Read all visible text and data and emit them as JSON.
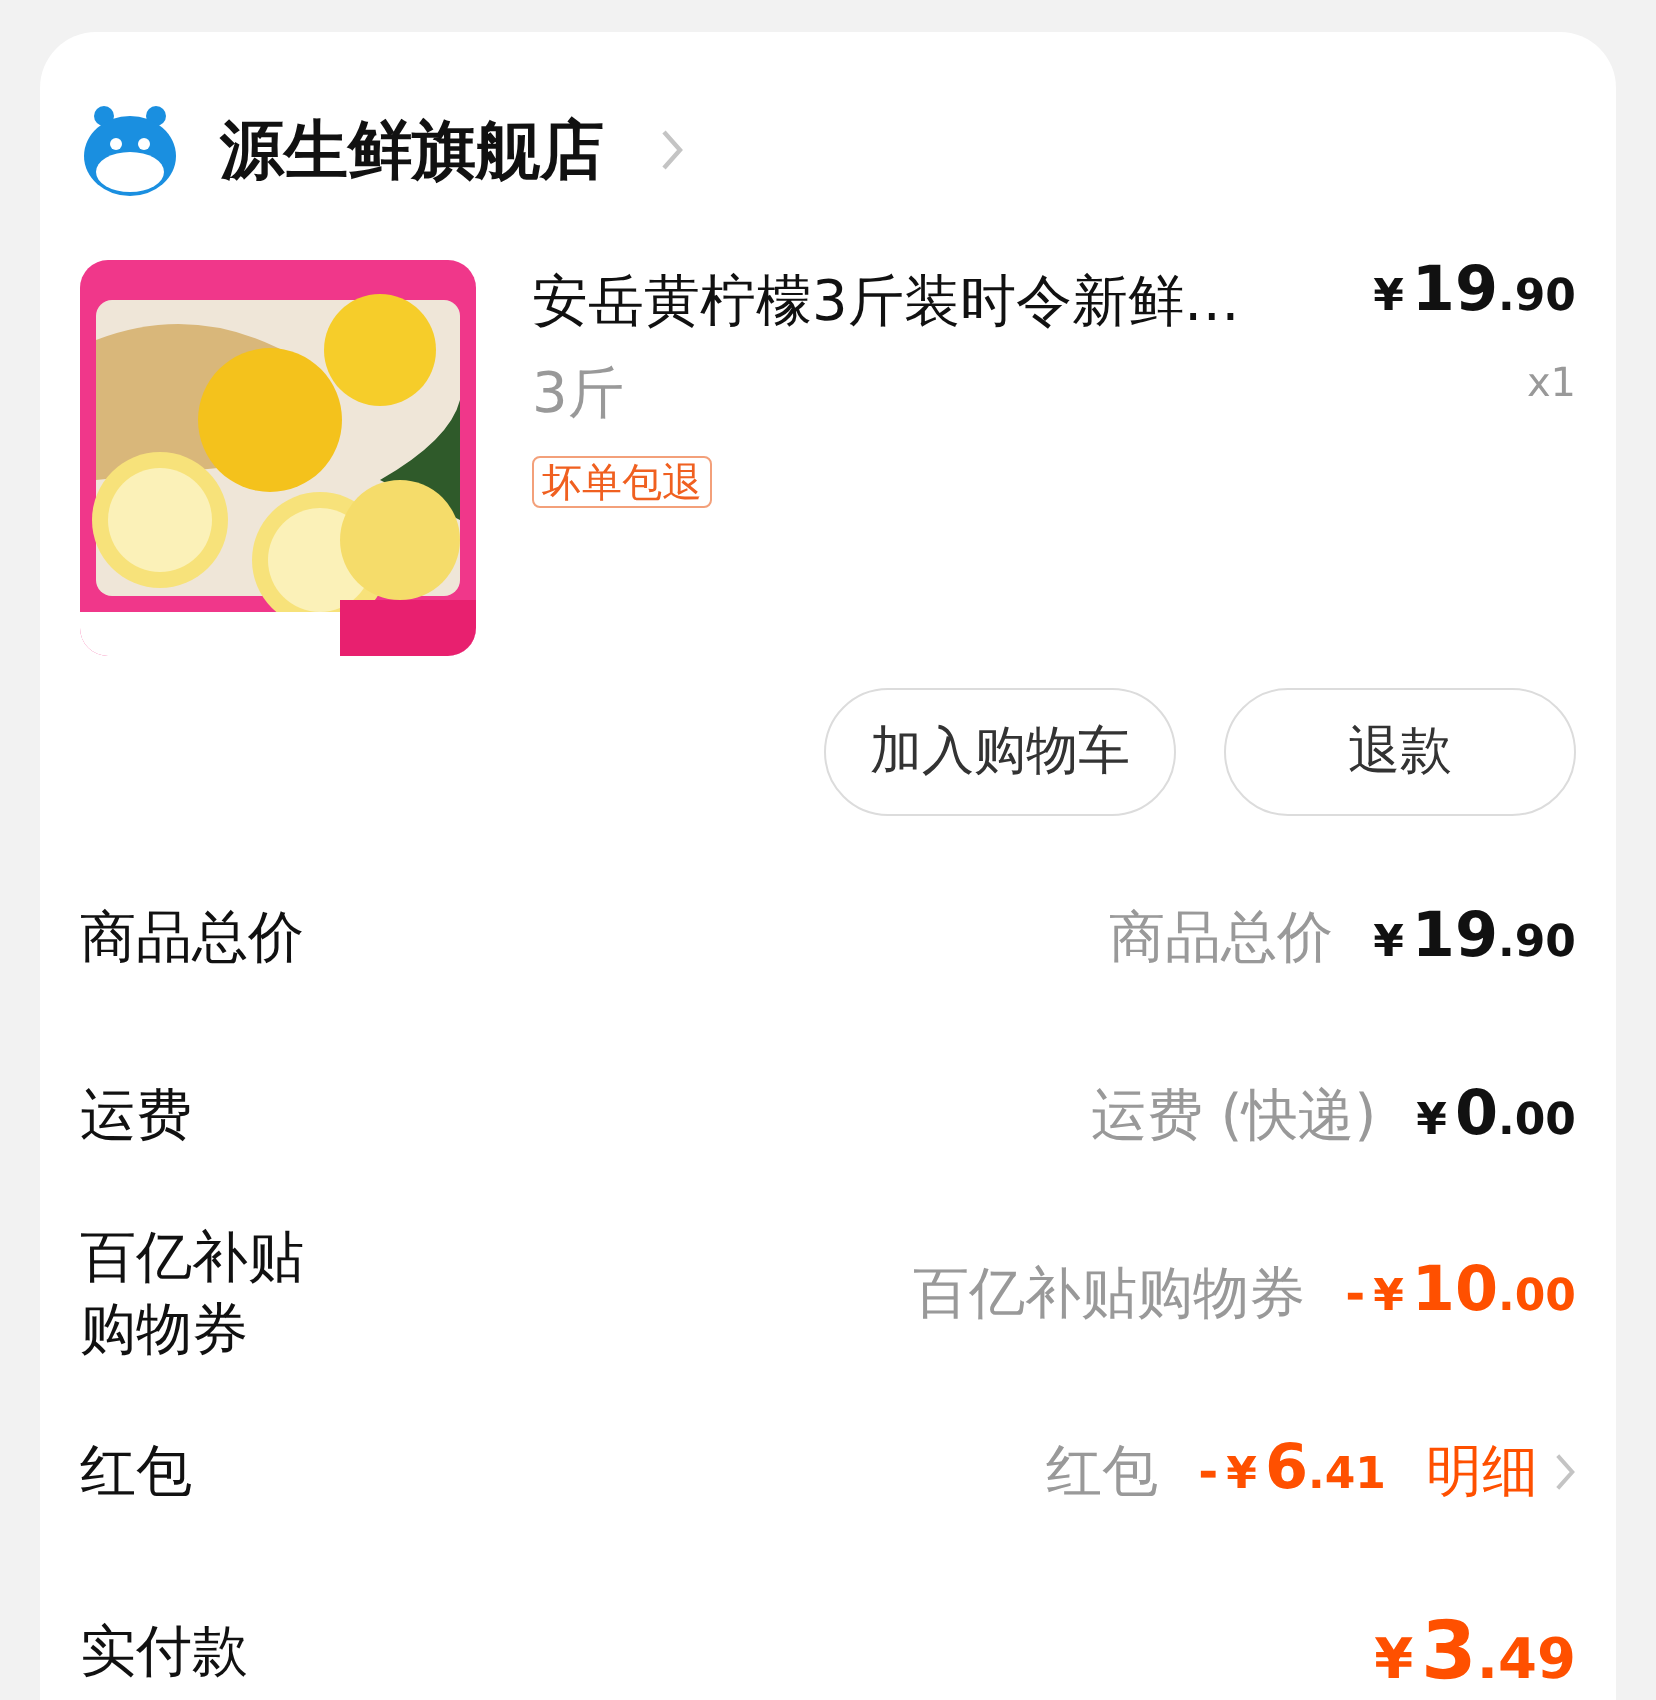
{
  "store": {
    "name": "源生鲜旗舰店"
  },
  "item": {
    "title": "安岳黄柠檬3斤装时令新鲜…",
    "spec": "3斤",
    "tag": "坏单包退",
    "price": {
      "symbol": "¥",
      "integer": "19",
      "decimal": ".90"
    },
    "quantity": "x1"
  },
  "actions": [
    "加入购物车",
    "退款"
  ],
  "fees": [
    {
      "kind": "plain",
      "label": "商品总价",
      "detail": "商品总价",
      "price": {
        "symbol": "¥",
        "integer": "19",
        "decimal": ".90"
      }
    },
    {
      "kind": "plain",
      "label": "运费",
      "detail": "运费 (快递)",
      "price": {
        "symbol": "¥",
        "integer": "0",
        "decimal": ".00"
      }
    },
    {
      "kind": "discount",
      "label": "百亿补贴购物券",
      "detail": "百亿补贴购物券",
      "sign": "-",
      "price": {
        "symbol": "¥",
        "integer": "10",
        "decimal": ".00"
      }
    },
    {
      "kind": "discount",
      "label": "红包",
      "detail": "红包",
      "sign": "-",
      "price": {
        "symbol": "¥",
        "integer": "6",
        "decimal": ".41"
      },
      "link": "明细"
    }
  ],
  "total": {
    "label": "实付款",
    "price": {
      "symbol": "¥",
      "integer": "3",
      "decimal": ".49"
    }
  }
}
